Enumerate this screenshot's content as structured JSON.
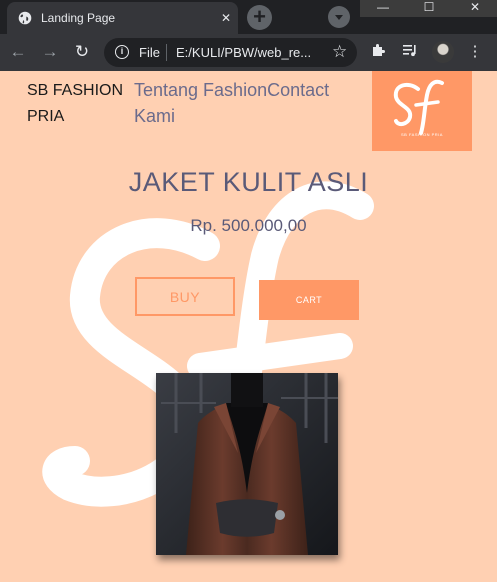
{
  "browser": {
    "tab_title": "Landing Page",
    "url_scheme": "File",
    "url": "E:/KULI/PBW/web_re..."
  },
  "page": {
    "brand": "SB FASHION PRIA",
    "nav": [
      "Tentang Fashion",
      "Contact Kami"
    ],
    "logo_text": "sf",
    "logo_subtext": "SB FASHION PRIA",
    "product_title": "JAKET KULIT ASLI",
    "price": "Rp. 500.000,00",
    "buy_label": "BUY",
    "cart_label": "CART"
  },
  "colors": {
    "page_bg": "#ffd0b2",
    "accent": "#ff9866",
    "heading": "#5a5a78"
  }
}
